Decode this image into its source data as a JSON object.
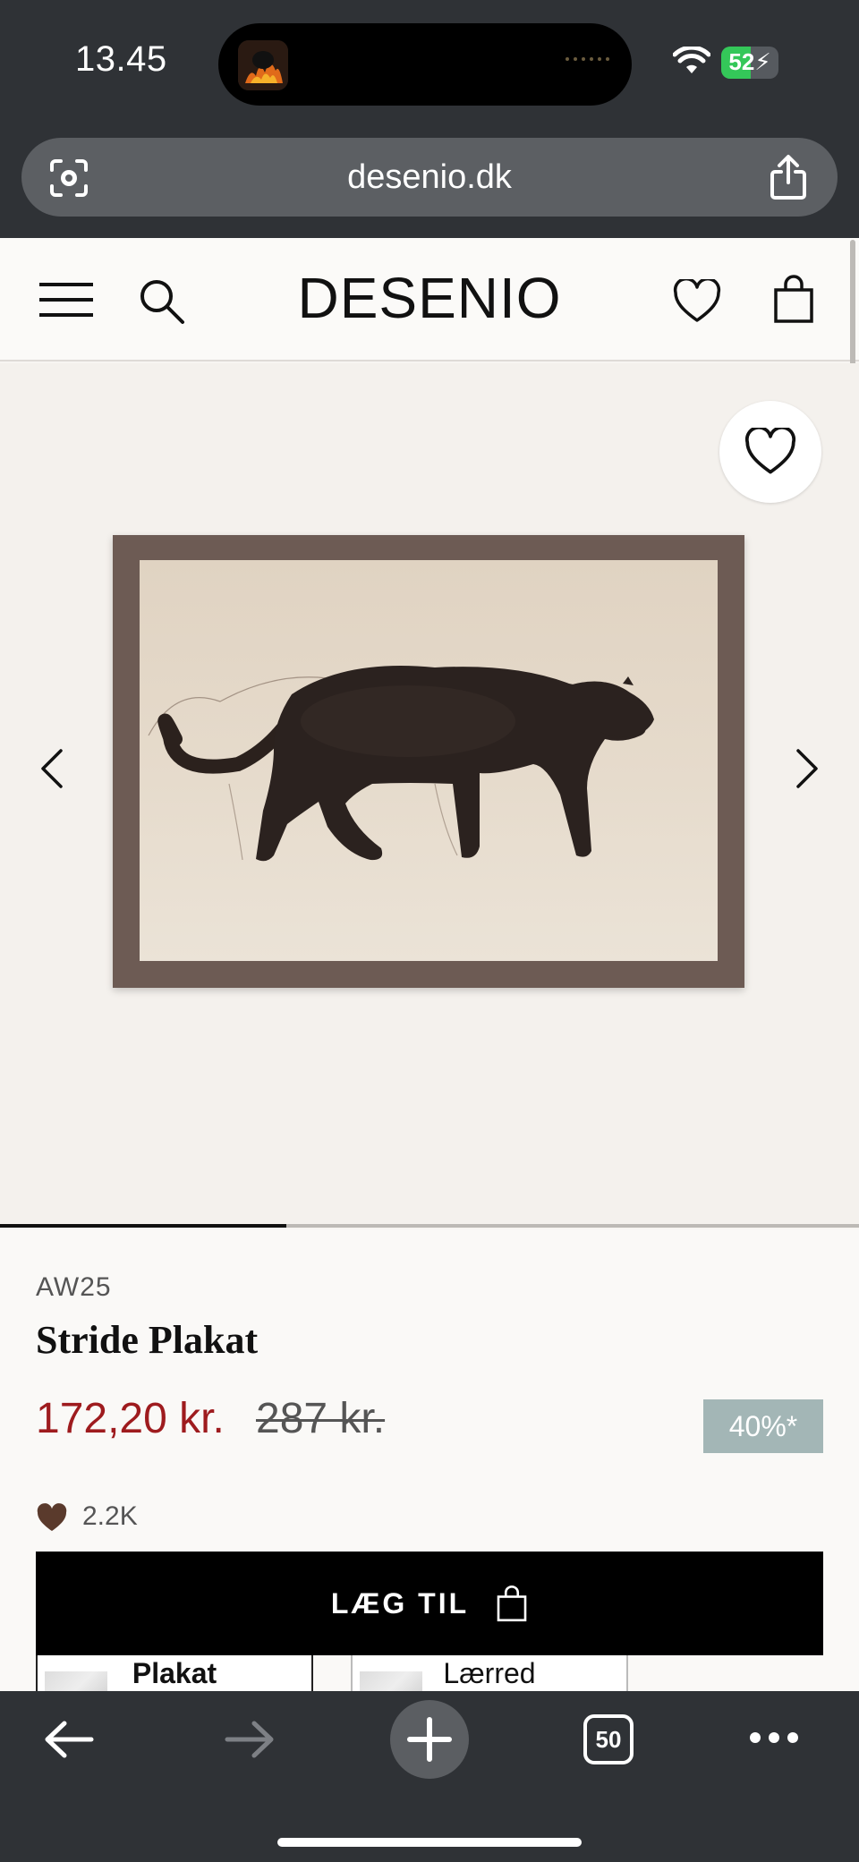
{
  "status_bar": {
    "time": "13.45",
    "battery_text": "52",
    "battery_level": 0.52
  },
  "browser": {
    "url": "desenio.dk",
    "tab_count": "50"
  },
  "site": {
    "logo": "DESENIO"
  },
  "gallery": {
    "progress_fraction": 0.333
  },
  "product": {
    "collection": "AW25",
    "title": "Stride Plakat",
    "price": "172,20 kr.",
    "old_price": "287 kr.",
    "discount": "40%*",
    "likes": "2.2K",
    "add_to_cart_label": "LÆG TIL",
    "options": [
      {
        "label": "Plakat"
      },
      {
        "label": "Lærred"
      }
    ]
  },
  "colors": {
    "price_red": "#9e1b1e",
    "discount_badge": "#a3b6b6",
    "frame": "#6d5b54",
    "chrome_dark": "#2f3236"
  }
}
